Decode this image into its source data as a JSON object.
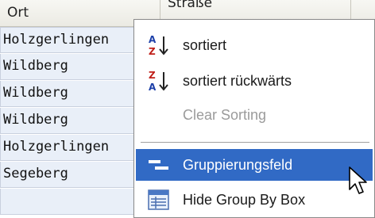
{
  "grid": {
    "columns": [
      "Ort",
      "Straße",
      ""
    ],
    "rows": [
      "Holzgerlingen",
      "Wildberg",
      "Wildberg",
      "Wildberg",
      "Holzgerlingen",
      "Segeberg",
      ""
    ]
  },
  "context_menu": {
    "items": [
      {
        "label": "sortiert",
        "icon": "sort-ascending-az-icon",
        "enabled": true
      },
      {
        "label": "sortiert rückwärts",
        "icon": "sort-descending-za-icon",
        "enabled": true
      },
      {
        "label": "Clear Sorting",
        "icon": "",
        "enabled": false
      },
      {
        "label": "Gruppierungsfeld",
        "icon": "group-by-field-icon",
        "enabled": true,
        "highlighted": true
      },
      {
        "label": "Hide Group By Box",
        "icon": "group-by-box-icon",
        "enabled": true
      }
    ]
  },
  "colors": {
    "menu_highlight": "#316ac5",
    "row_background": "#e9eff8"
  }
}
